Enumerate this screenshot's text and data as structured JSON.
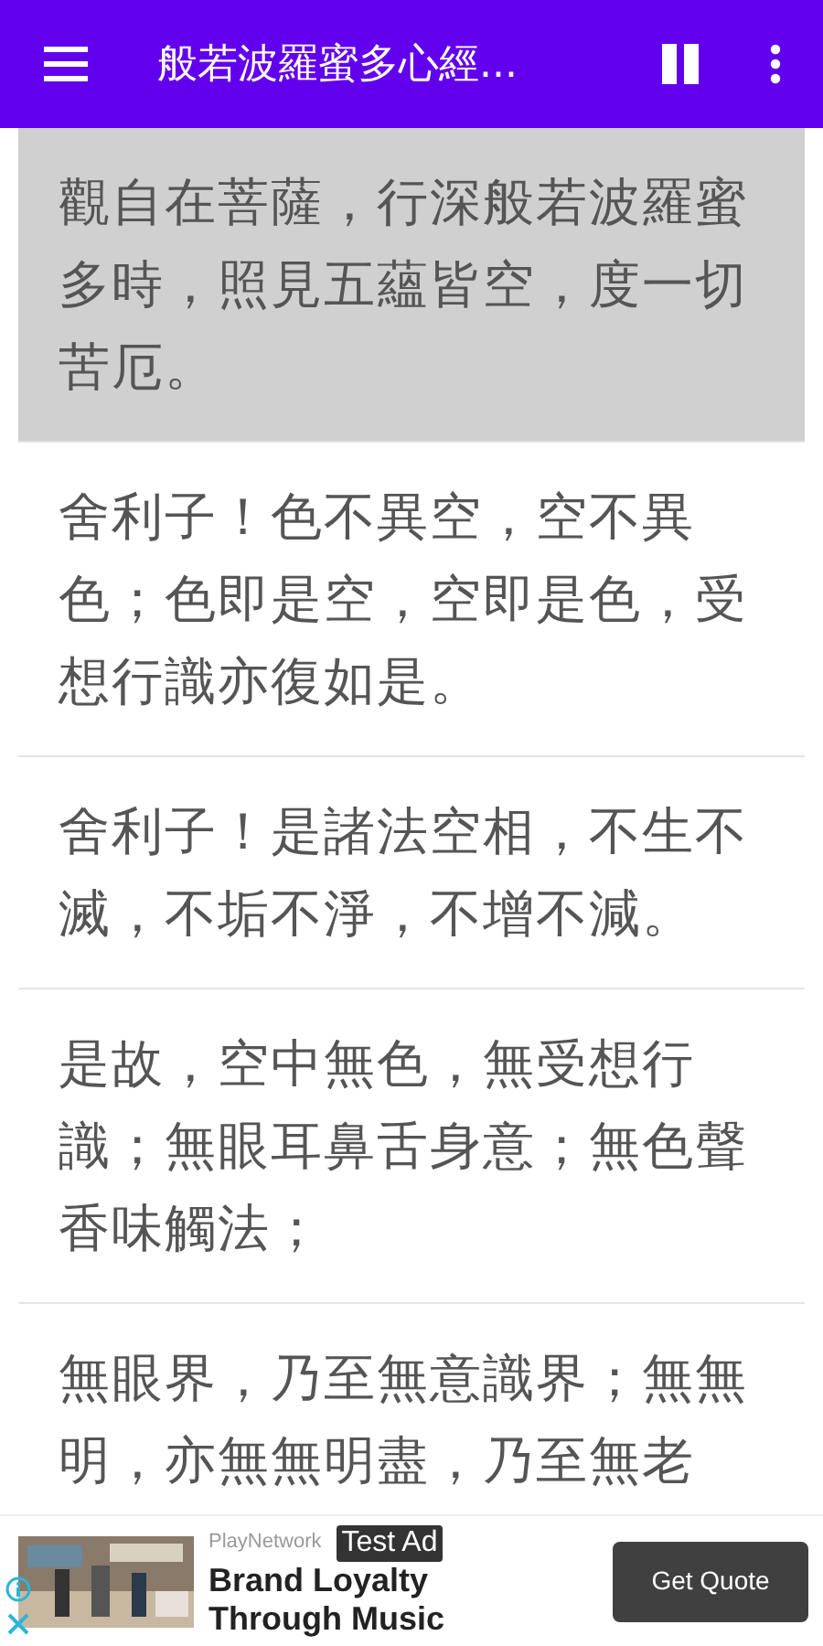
{
  "app_bar": {
    "title": "般若波羅蜜多心經..."
  },
  "verses": [
    {
      "text": "觀自在菩薩，行深般若波羅蜜多時，照見五蘊皆空，度一切苦厄。",
      "selected": true
    },
    {
      "text": "舍利子！色不異空，空不異色；色即是空，空即是色，受想行識亦復如是。",
      "selected": false
    },
    {
      "text": "舍利子！是諸法空相，不生不滅，不垢不淨，不增不減。",
      "selected": false
    },
    {
      "text": "是故，空中無色，無受想行識；無眼耳鼻舌身意；無色聲香味觸法；",
      "selected": false
    },
    {
      "text": "無眼界，乃至無意識界；無無明，亦無無明盡，乃至無老",
      "selected": false
    }
  ],
  "ad": {
    "advertiser": "PlayNetwork",
    "badge": "Test Ad",
    "headline": "Brand Loyalty Through Music",
    "button": "Get Quote"
  }
}
